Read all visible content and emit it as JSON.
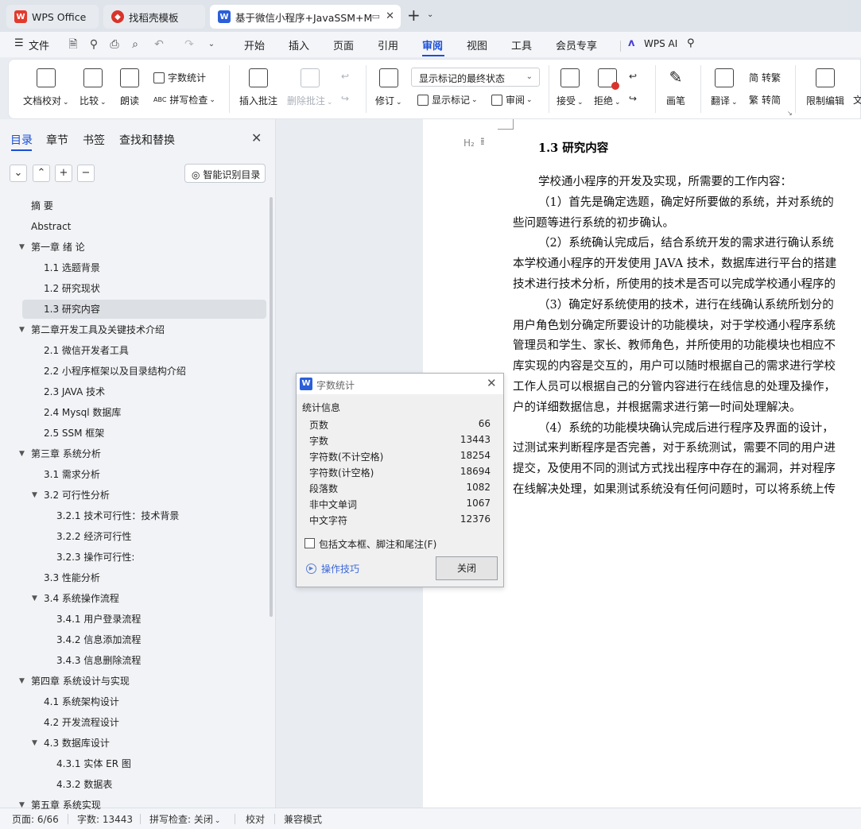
{
  "tabs": [
    {
      "label": "WPS Office",
      "icon": "wps-logo-icon"
    },
    {
      "label": "找稻壳模板",
      "icon": "docer-icon"
    },
    {
      "label": "基于微信小程序+JavaSSM+M",
      "icon": "word-doc-icon"
    }
  ],
  "menu": {
    "file": "文件",
    "items": [
      "开始",
      "插入",
      "页面",
      "引用",
      "审阅",
      "视图",
      "工具",
      "会员专享"
    ],
    "active": "审阅",
    "wps_ai": "WPS AI"
  },
  "ribbon": {
    "doc_check": "文档校对",
    "compare": "比较",
    "read_aloud": "朗读",
    "word_count": "字数统计",
    "spell_check": "拼写检查",
    "insert_comment": "插入批注",
    "delete_comment": "删除批注",
    "track_changes": "修订",
    "markup_state": "显示标记的最终状态",
    "show_markup": "显示标记",
    "review_pane": "审阅",
    "accept": "接受",
    "reject": "拒绝",
    "pen": "画笔",
    "translate": "翻译",
    "to_traditional": "转繁",
    "to_simplified": "转简",
    "restrict_edit": "限制编辑",
    "more": "文"
  },
  "nav_panel": {
    "tabs": [
      "目录",
      "章节",
      "书签",
      "查找和替换"
    ],
    "smart_toc": "智能识别目录",
    "toc": [
      {
        "text": "摘    要",
        "level": 0,
        "caret": false
      },
      {
        "text": "Abstract",
        "level": 0,
        "caret": false
      },
      {
        "text": "第一章  绪  论",
        "level": 0,
        "caret": true
      },
      {
        "text": "1.1 选题背景",
        "level": 1,
        "caret": false
      },
      {
        "text": "1.2 研究现状",
        "level": 1,
        "caret": false
      },
      {
        "text": "1.3 研究内容",
        "level": 1,
        "caret": false,
        "selected": true
      },
      {
        "text": "第二章开发工具及关键技术介绍",
        "level": 0,
        "caret": true
      },
      {
        "text": "2.1 微信开发者工具",
        "level": 1,
        "caret": false
      },
      {
        "text": "2.2 小程序框架以及目录结构介绍",
        "level": 1,
        "caret": false
      },
      {
        "text": "2.3 JAVA 技术",
        "level": 1,
        "caret": false
      },
      {
        "text": "2.4    Mysql 数据库",
        "level": 1,
        "caret": false
      },
      {
        "text": "2.5 SSM 框架",
        "level": 1,
        "caret": false
      },
      {
        "text": "第三章  系统分析",
        "level": 0,
        "caret": true
      },
      {
        "text": "3.1 需求分析",
        "level": 1,
        "caret": false
      },
      {
        "text": "3.2 可行性分析",
        "level": 1,
        "caret": true
      },
      {
        "text": "3.2.1 技术可行性：技术背景",
        "level": 2,
        "caret": false
      },
      {
        "text": "3.2.2 经济可行性",
        "level": 2,
        "caret": false
      },
      {
        "text": "3.2.3 操作可行性:",
        "level": 2,
        "caret": false
      },
      {
        "text": "3.3 性能分析",
        "level": 1,
        "caret": false
      },
      {
        "text": "3.4 系统操作流程",
        "level": 1,
        "caret": true
      },
      {
        "text": "3.4.1 用户登录流程",
        "level": 2,
        "caret": false
      },
      {
        "text": "3.4.2 信息添加流程",
        "level": 2,
        "caret": false
      },
      {
        "text": "3.4.3 信息删除流程",
        "level": 2,
        "caret": false
      },
      {
        "text": "第四章  系统设计与实现",
        "level": 0,
        "caret": true
      },
      {
        "text": "4.1 系统架构设计",
        "level": 1,
        "caret": false
      },
      {
        "text": "4.2 开发流程设计",
        "level": 1,
        "caret": false
      },
      {
        "text": "4.3 数据库设计",
        "level": 1,
        "caret": true
      },
      {
        "text": "4.3.1 实体 ER 图",
        "level": 2,
        "caret": false
      },
      {
        "text": "4.3.2 数据表",
        "level": 2,
        "caret": false
      },
      {
        "text": "第五章  系统实现",
        "level": 0,
        "caret": true
      }
    ]
  },
  "document": {
    "h2_marker": "H₂",
    "heading": "1.3 研究内容",
    "lines": [
      {
        "text": "学校通小程序的开发及实现，所需要的工作内容：",
        "indent": true
      },
      {
        "text": "（1）首先是确定选题，确定好所要做的系统，并对系统的",
        "indent": true
      },
      {
        "text": "些问题等进行系统的初步确认。",
        "indent": false
      },
      {
        "text": "（2）系统确认完成后，结合系统开发的需求进行确认系统",
        "indent": true
      },
      {
        "text": "本学校通小程序的开发使用 JAVA 技术，数据库进行平台的搭建",
        "indent": false
      },
      {
        "text": "技术进行技术分析，所使用的技术是否可以完成学校通小程序的",
        "indent": false
      },
      {
        "text": "（3）确定好系统使用的技术，进行在线确认系统所划分的",
        "indent": true
      },
      {
        "text": "用户角色划分确定所要设计的功能模块，对于学校通小程序系统",
        "indent": false
      },
      {
        "text": "管理员和学生、家长、教师角色，并所使用的功能模块也相应不",
        "indent": false
      },
      {
        "text": "库实现的内容是交互的，用户可以随时根据自己的需求进行学校",
        "indent": false
      },
      {
        "text": "工作人员可以根据自己的分管内容进行在线信息的处理及操作，",
        "indent": false
      },
      {
        "text": "户的详细数据信息，并根据需求进行第一时间处理解决。",
        "indent": false
      },
      {
        "text": "（4）系统的功能模块确认完成后进行程序及界面的设计，",
        "indent": true
      },
      {
        "text": "过测试来判断程序是否完善，对于系统测试，需要不同的用户进",
        "indent": false
      },
      {
        "text": "提交，及使用不同的测试方式找出程序中存在的漏洞，并对程序",
        "indent": false
      },
      {
        "text": "在线解决处理，如果测试系统没有任何问题时，可以将系统上传",
        "indent": false
      }
    ]
  },
  "word_count_dialog": {
    "title": "字数统计",
    "section": "统计信息",
    "stats": [
      {
        "label": "页数",
        "value": "66"
      },
      {
        "label": "字数",
        "value": "13443"
      },
      {
        "label": "字符数(不计空格)",
        "value": "18254"
      },
      {
        "label": "字符数(计空格)",
        "value": "18694"
      },
      {
        "label": "段落数",
        "value": "1082"
      },
      {
        "label": "非中文单词",
        "value": "1067"
      },
      {
        "label": "中文字符",
        "value": "12376"
      }
    ],
    "checkbox_label": "包括文本框、脚注和尾注(F)",
    "tips": "操作技巧",
    "close": "关闭"
  },
  "statusbar": {
    "page": "页面: 6/66",
    "words": "字数: 13443",
    "spell": "拼写检查: 关闭",
    "proof": "校对",
    "compat": "兼容模式"
  },
  "colors": {
    "accent": "#1a4fd6",
    "wps_red": "#e23b2e",
    "docer_red": "#d9342b",
    "doc_blue": "#2b5fd9"
  }
}
